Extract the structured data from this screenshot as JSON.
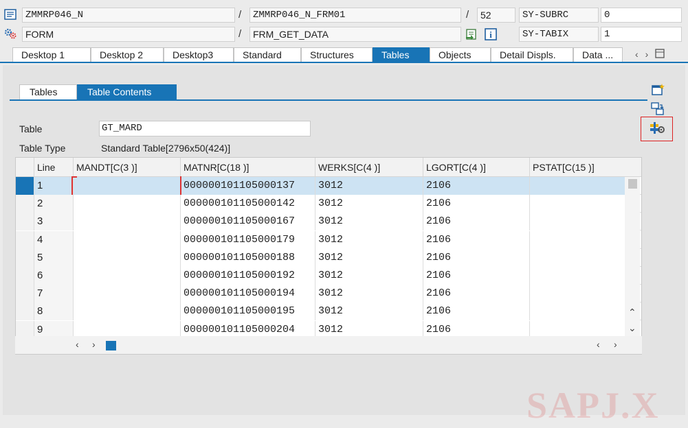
{
  "header": {
    "program": "ZMMRP046_N",
    "include": "ZMMRP046_N_FRM01",
    "line_number": "52",
    "sys_field_1_name": "SY-SUBRC",
    "sys_field_1_value": "0",
    "event_type": "FORM",
    "event_name": "FRM_GET_DATA",
    "sys_field_2_name": "SY-TABIX",
    "sys_field_2_value": "1",
    "slash": "/",
    "info_symbol": "i"
  },
  "desktop_tabs": [
    {
      "label": "Desktop 1",
      "active": false
    },
    {
      "label": "Desktop 2",
      "active": false
    },
    {
      "label": "Desktop3",
      "active": false
    },
    {
      "label": "Standard",
      "active": false
    },
    {
      "label": "Structures",
      "active": false
    },
    {
      "label": "Tables",
      "active": true
    },
    {
      "label": "Objects",
      "active": false
    },
    {
      "label": "Detail Displs.",
      "active": false
    },
    {
      "label": "Data ...",
      "active": false
    }
  ],
  "sub_tabs": [
    {
      "label": "Tables",
      "active": false
    },
    {
      "label": "Table Contents",
      "active": true
    }
  ],
  "table_info": {
    "table_label": "Table",
    "table_name": "GT_MARD",
    "type_label": "Table Type",
    "type_value": "Standard Table[2796x50(424)]"
  },
  "grid": {
    "columns": [
      "Line",
      "MANDT[C(3 )]",
      "MATNR[C(18 )]",
      "WERKS[C(4 )]",
      "LGORT[C(4 )]",
      "PSTAT[C(15 )]"
    ],
    "rows": [
      [
        "1",
        "",
        "000000101105000137",
        "3012",
        "2106",
        ""
      ],
      [
        "2",
        "",
        "000000101105000142",
        "3012",
        "2106",
        ""
      ],
      [
        "3",
        "",
        "000000101105000167",
        "3012",
        "2106",
        ""
      ],
      [
        "4",
        "",
        "000000101105000179",
        "3012",
        "2106",
        ""
      ],
      [
        "5",
        "",
        "000000101105000188",
        "3012",
        "2106",
        ""
      ],
      [
        "6",
        "",
        "000000101105000192",
        "3012",
        "2106",
        ""
      ],
      [
        "7",
        "",
        "000000101105000194",
        "3012",
        "2106",
        ""
      ],
      [
        "8",
        "",
        "000000101105000195",
        "3012",
        "2106",
        ""
      ],
      [
        "9",
        "",
        "000000101105000204",
        "3012",
        "2106",
        ""
      ]
    ],
    "selected_row": 0
  },
  "icons": {
    "program": "program-icon",
    "event": "gears-icon",
    "jump": "jump-to-source-icon",
    "info": "info-icon",
    "new_tool": "new-tool-icon",
    "replace_tool": "replace-tool-icon",
    "services": "tool-services-icon",
    "scroll_left": "chevron-left-icon",
    "scroll_right": "chevron-right-icon",
    "scroll_up": "chevron-up-icon",
    "scroll_down": "chevron-down-icon",
    "tab_menu": "tab-list-icon"
  },
  "colors": {
    "accent": "#1874b6",
    "selection": "#cde3f3",
    "highlight_border": "#dd2222"
  },
  "watermark": "SAPJ.X"
}
